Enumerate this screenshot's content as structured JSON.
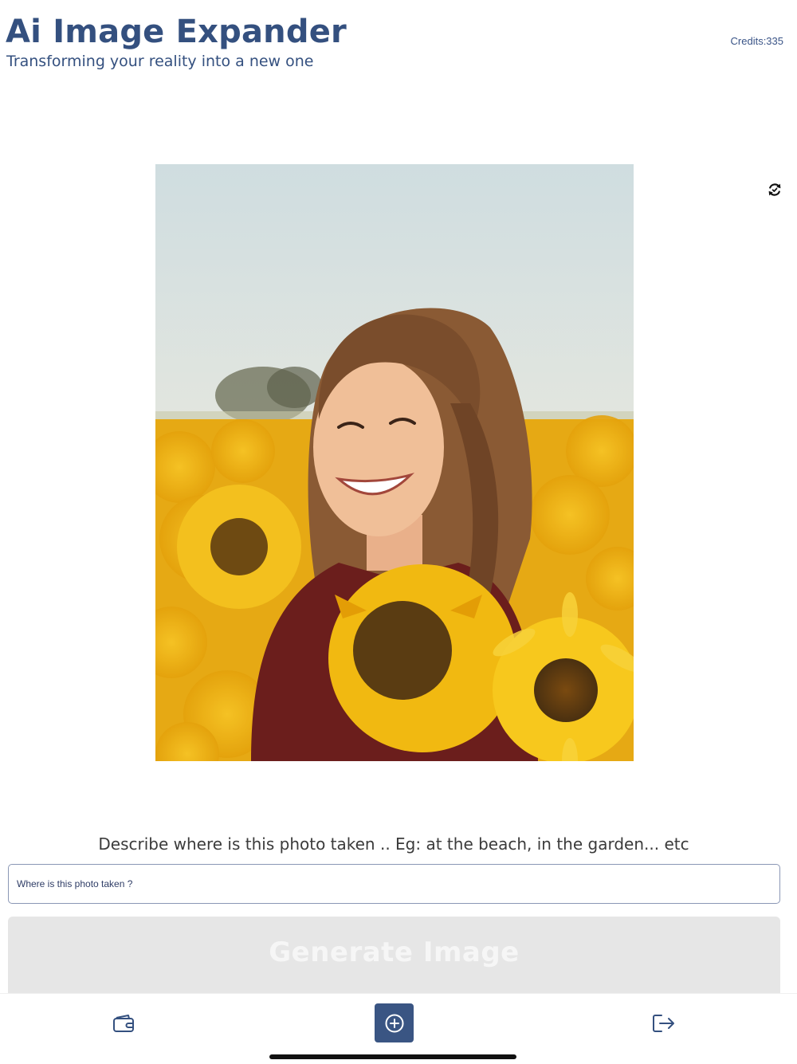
{
  "header": {
    "title": "Ai Image Expander",
    "subtitle": "Transforming your reality into a new one",
    "credits": "Credits:335"
  },
  "controls": {
    "rotate_icon": "rotate-arrows-icon"
  },
  "photo": {
    "description_icon": "uploaded-photo"
  },
  "prompt": {
    "label": "Describe where is this photo taken .. Eg: at the beach, in the garden... etc",
    "placeholder": "Where is this photo taken ?",
    "value": ""
  },
  "generate": {
    "label": "Generate Image",
    "enabled": false
  },
  "tabbar": {
    "items": [
      {
        "icon": "wallet-icon"
      },
      {
        "icon": "add-circle-icon",
        "active": true
      },
      {
        "icon": "logout-icon"
      }
    ]
  },
  "colors": {
    "accent": "#3a5583",
    "title": "#34507f",
    "button_disabled": "#e6e6e6"
  }
}
